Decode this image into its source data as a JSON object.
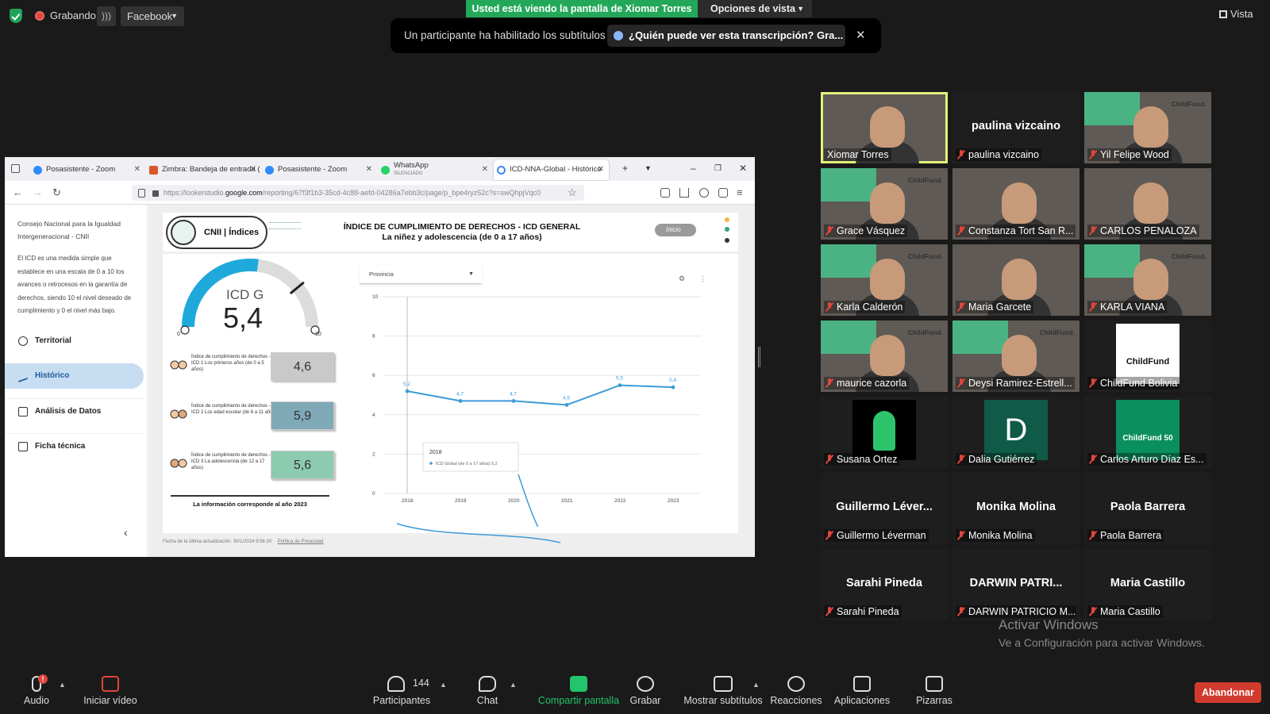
{
  "topbar": {
    "recording_label": "Grabando",
    "stream_label": "Facebook",
    "viewing_banner": "Usted está viendo la pantalla de Xiomar Torres",
    "view_options": "Opciones de vista",
    "vista_label": "Vista"
  },
  "caption_notice": {
    "text": "Un participante ha habilitado los subtítulos",
    "question": "¿Quién puede ver esta transcripción? Gra..."
  },
  "browser": {
    "tabs": [
      {
        "label": "Posasistente - Zoom"
      },
      {
        "label": "Zimbra: Bandeja de entrada ("
      },
      {
        "label": "Posasistente - Zoom"
      },
      {
        "label": "WhatsApp",
        "sub": "SILENCIADO"
      },
      {
        "label": "ICD-NNA-Global - Histórico"
      }
    ],
    "url_prefix": "https://lookerstudio.",
    "url_domain": "google.com",
    "url_rest": "/reporting/67f3f1b3-35cd-4c88-aefd-04286a7ebb3c/page/p_bpe4ryz52c?s=swQhpjVqc0"
  },
  "report_nav": {
    "org": "Consejo Nacional para la Igualdad Intergeneracional - CNII",
    "description": "El ICD es una medida simple que establece en una escala de 0 a 10 los avances o retrocesos en la garantía de derechos, siendo 10 el nivel deseado de cumplimiento y 0 el nivel más bajo.",
    "items": [
      {
        "label": "Territorial",
        "icon": "globe-icon"
      },
      {
        "label": "Histórico",
        "icon": "trend-icon"
      },
      {
        "label": "Análisis de Datos",
        "icon": "chart-icon"
      },
      {
        "label": "Ficha técnica",
        "icon": "document-icon"
      }
    ]
  },
  "report": {
    "logo_text": "CNII | Índices",
    "title_line1": "ÍNDICE DE CUMPLIMIENTO DE DERECHOS - ICD GENERAL",
    "title_line2": "La niñez y adolescencia (de 0 a 17 años)",
    "inicio_label": "Inicio",
    "gauge_label": "ICD G",
    "gauge_value": "5,4",
    "gauge_fraction": 0.54,
    "gauge_min": "0",
    "gauge_max": "10",
    "sub_indices": [
      {
        "label": "Índice de cumplimiento de derechos - ICD 1 Los primeros años (de 0 a 5 años)",
        "value": "4,6",
        "color": "#c9c9c9"
      },
      {
        "label": "Índice de cumplimiento de derechos - ICD 2 Los edad escolar (de 6 a 11 años)",
        "value": "5,9",
        "color": "#7fa9b7"
      },
      {
        "label": "Índice de cumplimiento de derechos - ICD 3 La adolescencia (de 12 a 17 años)",
        "value": "5,6",
        "color": "#8ccbb0"
      }
    ],
    "note": "La información corresponde al año 2023",
    "filter_label": "Provincia",
    "footer": "Fecha de la última actualización: 30/1/2024 9:56:30",
    "privacy": "Política de Privacidad",
    "colors": {
      "gauge": "#1fa9db",
      "line": "#3d9bd8",
      "accent": "#4bb383"
    }
  },
  "chart_data": {
    "type": "line",
    "x": [
      "2018",
      "2019",
      "2020",
      "2021",
      "2022",
      "2023"
    ],
    "series": [
      {
        "name": "ICD Global (de 0 a 17 años)",
        "values": [
          5.2,
          4.7,
          4.7,
          4.5,
          5.5,
          5.4
        ]
      }
    ],
    "value_labels": [
      "5,2",
      "4,7",
      "4,7",
      "4,5",
      "5,5",
      "5,4"
    ],
    "y_ticks": [
      "0",
      "2",
      "4",
      "6",
      "8",
      "10"
    ],
    "ylim": [
      0,
      10
    ],
    "tooltip_title": "2018",
    "tooltip_entry": "ICD Global (de 0 a 17 años) 5,2"
  },
  "participants": [
    {
      "name": "Xiomar Torres",
      "video": true,
      "active": true
    },
    {
      "name": "paulina vizcaino",
      "display": "paulina vizcaino",
      "video": false
    },
    {
      "name": "Yil Felipe Wood",
      "video": true,
      "childfund": true
    },
    {
      "name": "Grace Vásquez",
      "video": true,
      "childfund": true
    },
    {
      "name": "Constanza Tort San R...",
      "video": true
    },
    {
      "name": "CARLOS PENALOZA",
      "video": true
    },
    {
      "name": "Karla Calderón",
      "video": true,
      "childfund": true
    },
    {
      "name": "Maria Garcete",
      "video": true
    },
    {
      "name": "KARLA VIANA",
      "video": true,
      "childfund": true
    },
    {
      "name": "maurice cazorla",
      "video": true,
      "childfund": true
    },
    {
      "name": "Deysi Ramirez-Estrell...",
      "video": true,
      "childfund": true
    },
    {
      "name": "ChildFund Bolivia",
      "avatar": "ChildFund"
    },
    {
      "name": "Susana Ortez",
      "avatar": "figure"
    },
    {
      "name": "Dalia Gutiérrez",
      "avatar": "D"
    },
    {
      "name": "Carlos Arturo Díaz Es...",
      "avatar": "ChildFund 50"
    },
    {
      "name": "Guillermo Léverman",
      "display": "Guillermo  Léver...",
      "video": false
    },
    {
      "name": "Monika Molina",
      "display": "Monika Molina",
      "video": false
    },
    {
      "name": "Paola Barrera",
      "display": "Paola Barrera",
      "video": false
    },
    {
      "name": "Sarahi Pineda",
      "display": "Sarahi Pineda",
      "video": false
    },
    {
      "name": "DARWIN PATRICIO M...",
      "display": "DARWIN PATRI...",
      "video": false
    },
    {
      "name": "Maria Castillo",
      "display": "Maria Castillo",
      "video": false
    }
  ],
  "watermark": {
    "line1": "Activar Windows",
    "line2": "Ve a Configuración para activar Windows."
  },
  "toolbar": {
    "audio": "Audio",
    "video": "Iniciar vídeo",
    "participants": "Participantes",
    "participant_count": "144",
    "chat": "Chat",
    "share": "Compartir pantalla",
    "record": "Grabar",
    "captions": "Mostrar subtítulos",
    "reactions": "Reacciones",
    "apps": "Aplicaciones",
    "whiteboards": "Pizarras",
    "leave": "Abandonar",
    "audio_badge": "!"
  }
}
